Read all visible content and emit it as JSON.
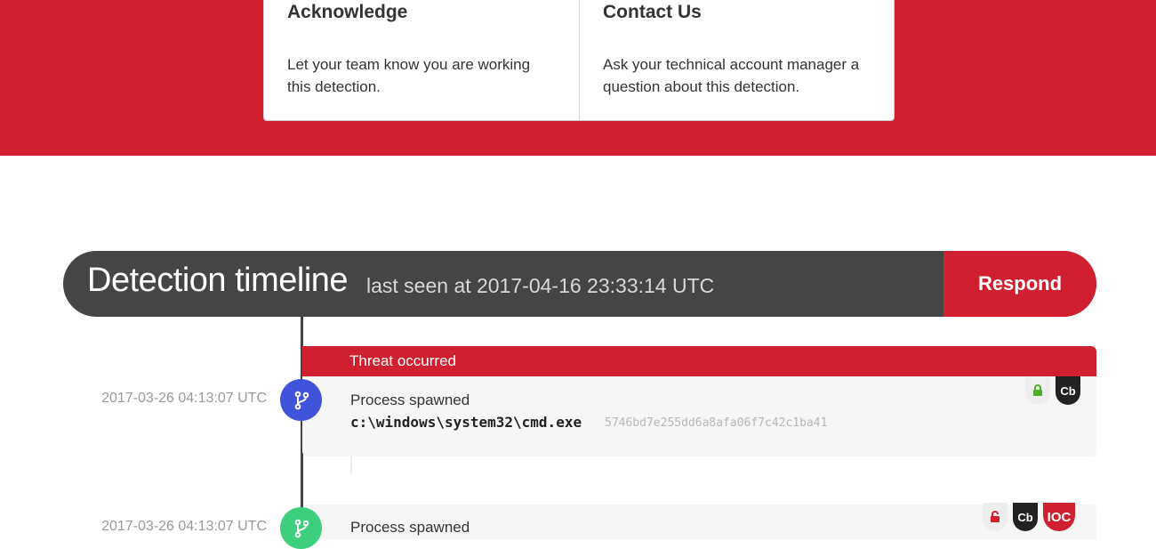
{
  "actions": {
    "acknowledge": {
      "title": "Acknowledge",
      "description": "Let your team know you are working this detection."
    },
    "contact": {
      "title": "Contact Us",
      "description": "Ask your technical account manager a question about this detection."
    }
  },
  "timeline": {
    "title": "Detection timeline",
    "last_seen": "last seen at 2017-04-16 23:33:14 UTC",
    "respond_label": "Respond",
    "threat_label": "Threat occurred",
    "events": [
      {
        "timestamp": "2017-03-26 04:13:07 UTC",
        "type": "Process spawned",
        "path": "c:\\windows\\system32\\cmd.exe",
        "hash": "5746bd7e255dd6a8afa06f7c42c1ba41",
        "badges": {
          "cb": "Cb"
        }
      },
      {
        "timestamp": "2017-03-26 04:13:07 UTC",
        "type": "Process spawned",
        "badges": {
          "cb": "Cb",
          "ioc": "IOC"
        }
      }
    ]
  },
  "colors": {
    "brand_red": "#d0202f",
    "header_dark": "#454545",
    "node_blue": "#4053db",
    "node_green": "#3ccf7c",
    "lock_green": "#4caf26",
    "lock_red": "#d0202f"
  },
  "icons": {
    "branch": "git-branch-icon",
    "lock_closed": "lock-icon",
    "lock_open": "unlock-icon"
  }
}
